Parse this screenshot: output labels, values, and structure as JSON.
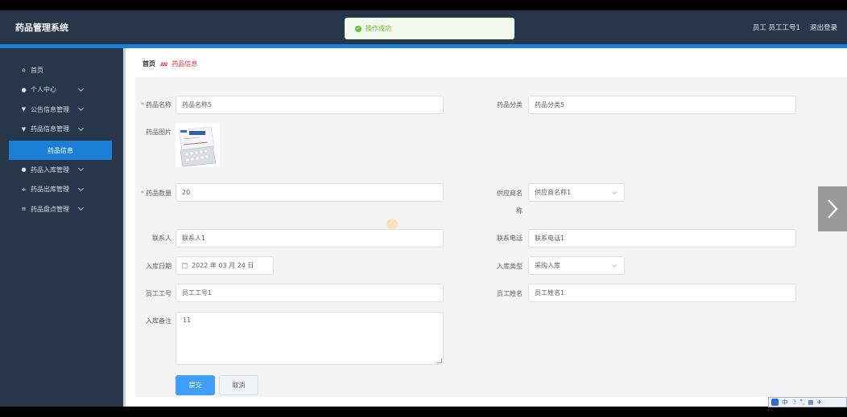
{
  "app": {
    "title": "药品管理系统"
  },
  "header": {
    "user_label": "员工 员工工号1",
    "logout_label": "退出登录"
  },
  "toast": {
    "message": "操作成功"
  },
  "sidebar": {
    "items": [
      {
        "label": "首页",
        "icon": "home-icon",
        "glyph": "⌂",
        "expandable": false
      },
      {
        "label": "个人中心",
        "icon": "user-icon",
        "glyph": "●",
        "expandable": true
      },
      {
        "label": "公告信息管理",
        "icon": "pin-icon",
        "glyph": "▼",
        "expandable": true
      },
      {
        "label": "药品信息管理",
        "icon": "pin-icon",
        "glyph": "▼",
        "expandable": true
      },
      {
        "label": "药品入库管理",
        "icon": "user-icon",
        "glyph": "●",
        "expandable": true
      },
      {
        "label": "药品出库管理",
        "icon": "sort-icon",
        "glyph": "≑",
        "expandable": true
      },
      {
        "label": "药品盘点管理",
        "icon": "list-icon",
        "glyph": "≡",
        "expandable": true
      }
    ],
    "active_sub": "药品信息"
  },
  "breadcrumb": {
    "home": "首页",
    "separator": "⅏",
    "current": "药品信息"
  },
  "form": {
    "drug_name": {
      "label": "药品名称",
      "value": "药品名称5"
    },
    "drug_category": {
      "label": "药品分类",
      "value": "药品分类5"
    },
    "drug_image": {
      "label": "药品图片"
    },
    "drug_quantity": {
      "label": "药品数量",
      "value": "20"
    },
    "supplier_name": {
      "label_1": "供应商名",
      "label_2": "称",
      "value": "供应商名称1"
    },
    "contact_person": {
      "label": "联系人",
      "value": "联系人1"
    },
    "contact_phone": {
      "label": "联系电话",
      "value": "联系电话1"
    },
    "stock_in_date": {
      "label": "入库日期",
      "value": "2022 年 03 月 24 日"
    },
    "stock_in_type": {
      "label": "入库类型",
      "value": "采购入库"
    },
    "employee_id": {
      "label": "员工工号",
      "value": "员工工号1"
    },
    "employee_name": {
      "label": "员工姓名",
      "value": "员工姓名1"
    },
    "remarks": {
      "label": "入库备注",
      "value": "11"
    },
    "submit_label": "提交",
    "cancel_label": "取消"
  },
  "ime": {
    "items": [
      "中",
      "☽",
      "°,",
      "▦",
      "✈"
    ]
  },
  "colors": {
    "header": "#273649",
    "accent": "#1a7fd6",
    "primary_button": "#409eff",
    "required": "#f56c6c",
    "success": "#67c23a"
  }
}
